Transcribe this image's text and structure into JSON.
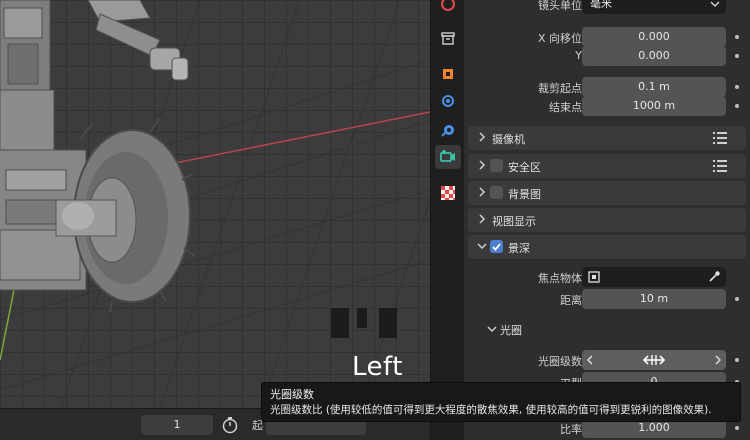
{
  "viewport": {
    "view_label": "Left"
  },
  "timeline": {
    "current_frame": "1",
    "start_label": "起"
  },
  "tabs": [
    {
      "name": "render-tab-icon",
      "color": "#e24b4b"
    },
    {
      "name": "output-tab-icon",
      "color": "#cfcfcf"
    },
    {
      "name": "object-tab-icon",
      "color": "#f0862b"
    },
    {
      "name": "modifier-tab-icon",
      "color": "#4b8fe8"
    },
    {
      "name": "physics-tab-icon",
      "color": "#4b8fe8"
    },
    {
      "name": "camera-data-tab-icon",
      "color": "#39c1a8"
    },
    {
      "name": "texture-tab-icon",
      "color": "#e24b4b"
    }
  ],
  "lens": {
    "unit_label": "镜头单位",
    "unit_value": "毫米",
    "shift_x_label": "X 向移位",
    "shift_x_value": "0.000",
    "shift_y_label": "Y",
    "shift_y_value": "0.000",
    "clip_start_label": "裁剪起点",
    "clip_start_value": "0.1 m",
    "clip_end_label": "结束点",
    "clip_end_value": "1000 m"
  },
  "sections": {
    "camera": "摄像机",
    "safe_areas": "安全区",
    "background_images": "背景图",
    "viewport_display": "视图显示",
    "depth_of_field": "景深"
  },
  "dof": {
    "enabled": true,
    "focus_object_label": "焦点物体",
    "distance_label": "距离",
    "distance_value": "10 m",
    "aperture_title": "光圈",
    "fstop_label": "光圈级数",
    "blades_label": "刃型",
    "blades_value": "0",
    "ratio_label": "比率",
    "ratio_value": "1.000"
  },
  "tooltip": {
    "title": "光圈级数",
    "description": "光圈级数比 (使用较低的值可得到更大程度的散焦效果, 使用较高的值可得到更锐利的图像效果)."
  }
}
